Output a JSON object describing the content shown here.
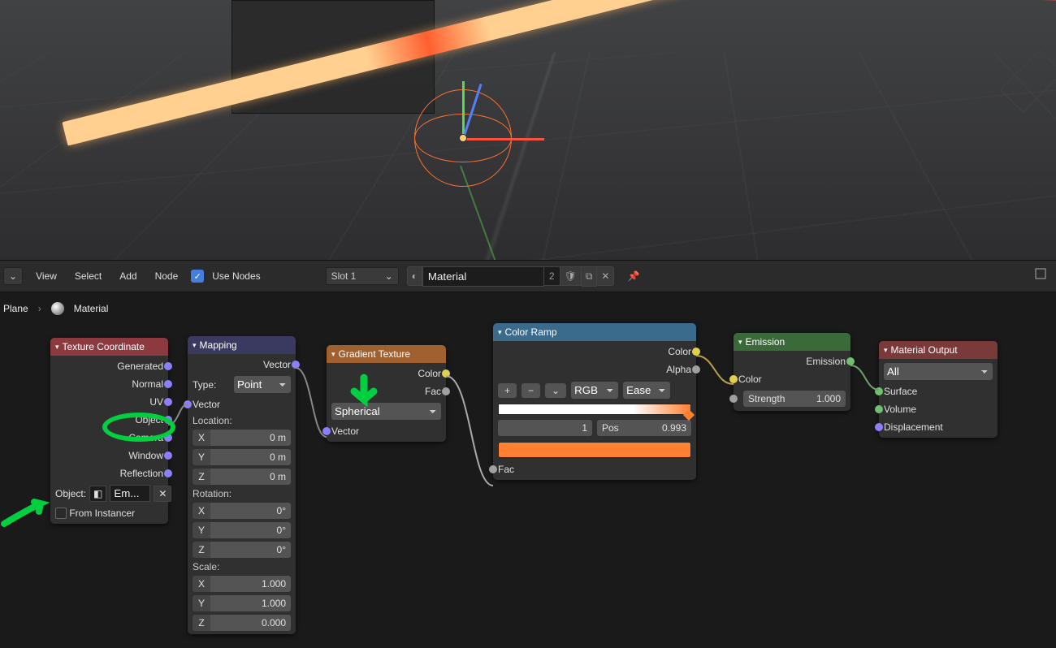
{
  "viewport": {},
  "toolbar": {
    "menus": {
      "view": "View",
      "select": "Select",
      "add": "Add",
      "node": "Node"
    },
    "use_nodes_label": "Use Nodes",
    "use_nodes_checked": true,
    "slot": "Slot 1",
    "material_name": "Material",
    "user_count": "2"
  },
  "breadcrumb": {
    "object": "Plane",
    "material": "Material"
  },
  "nodes": {
    "tex_coord": {
      "title": "Texture Coordinate",
      "outputs": [
        "Generated",
        "Normal",
        "UV",
        "Object",
        "Camera",
        "Window",
        "Reflection"
      ],
      "object_label": "Object:",
      "object_value": "Em...",
      "from_instancer_label": "From Instancer"
    },
    "mapping": {
      "title": "Mapping",
      "vector_out": "Vector",
      "type_label": "Type:",
      "type_value": "Point",
      "vector_in": "Vector",
      "location_label": "Location:",
      "location": {
        "x": "0 m",
        "y": "0 m",
        "z": "0 m"
      },
      "rotation_label": "Rotation:",
      "rotation": {
        "x": "0°",
        "y": "0°",
        "z": "0°"
      },
      "scale_label": "Scale:",
      "scale": {
        "x": "1.000",
        "y": "1.000",
        "z": "0.000"
      }
    },
    "gradient": {
      "title": "Gradient Texture",
      "color_out": "Color",
      "fac_out": "Fac",
      "type_value": "Spherical",
      "vector_in": "Vector"
    },
    "color_ramp": {
      "title": "Color Ramp",
      "color_out": "Color",
      "alpha_out": "Alpha",
      "mode": "RGB",
      "interp": "Ease",
      "stop_index": "1",
      "pos_label": "Pos",
      "pos_value": "0.993",
      "fac_in": "Fac"
    },
    "emission": {
      "title": "Emission",
      "emission_out": "Emission",
      "color_in": "Color",
      "strength_label": "Strength",
      "strength_value": "1.000"
    },
    "mat_output": {
      "title": "Material Output",
      "target": "All",
      "surface": "Surface",
      "volume": "Volume",
      "displacement": "Displacement"
    }
  },
  "axes": {
    "x": "X",
    "y": "Y",
    "z": "Z"
  }
}
